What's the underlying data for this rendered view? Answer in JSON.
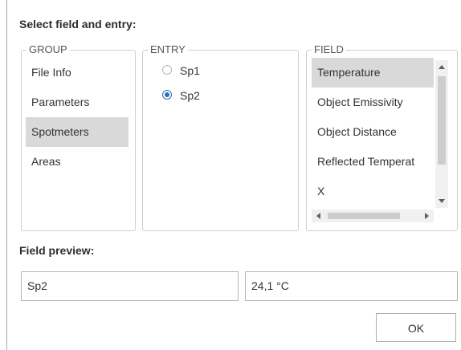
{
  "dialog": {
    "select_title": "Select field and entry:",
    "preview_title": "Field preview:",
    "ok_label": "OK"
  },
  "group": {
    "legend": "GROUP",
    "items": [
      "File Info",
      "Parameters",
      "Spotmeters",
      "Areas"
    ],
    "selected": "Spotmeters"
  },
  "entry": {
    "legend": "ENTRY",
    "options": [
      "Sp1",
      "Sp2"
    ],
    "selected": "Sp2"
  },
  "field": {
    "legend": "FIELD",
    "items": [
      "Temperature",
      "Object Emissivity",
      "Object Distance",
      "Reflected Temperat",
      "X"
    ],
    "selected": "Temperature"
  },
  "preview": {
    "name_value": "Sp2",
    "value_value": "24,1 °C"
  },
  "icons": {
    "scroll_up": "chevron-up-icon",
    "scroll_down": "chevron-down-icon",
    "scroll_left": "chevron-left-icon",
    "scroll_right": "chevron-right-icon"
  }
}
